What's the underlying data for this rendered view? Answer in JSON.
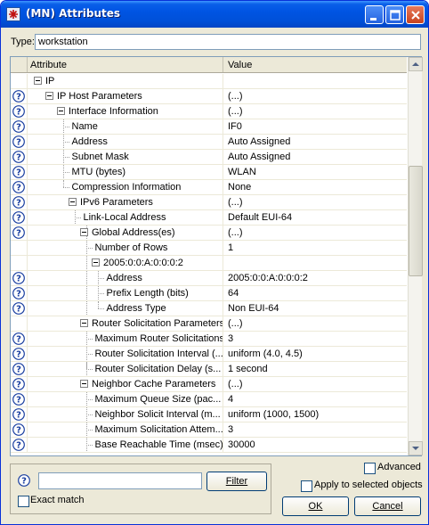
{
  "window": {
    "title": "(MN) Attributes",
    "title_icon": "asterisk-app-icon",
    "controls": {
      "minimize_icon": "minimize-icon",
      "maximize_icon": "maximize-icon",
      "close_icon": "close-icon"
    }
  },
  "type_field": {
    "label": "Type:",
    "value": "workstation"
  },
  "table": {
    "headers": {
      "attribute": "Attribute",
      "value": "Value"
    },
    "rows": [
      {
        "name": "IP",
        "value": ""
      },
      {
        "name": "IP Host Parameters",
        "value": "(...)"
      },
      {
        "name": "Interface Information",
        "value": "(...)"
      },
      {
        "name": "Name",
        "value": "IF0"
      },
      {
        "name": "Address",
        "value": "Auto Assigned"
      },
      {
        "name": "Subnet Mask",
        "value": "Auto Assigned"
      },
      {
        "name": "MTU (bytes)",
        "value": "WLAN"
      },
      {
        "name": "Compression Information",
        "value": "None"
      },
      {
        "name": "IPv6 Parameters",
        "value": "(...)"
      },
      {
        "name": "Link-Local Address",
        "value": "Default EUI-64"
      },
      {
        "name": "Global Address(es)",
        "value": "(...)"
      },
      {
        "name": "Number of Rows",
        "value": "1"
      },
      {
        "name": "2005:0:0:A:0:0:0:2",
        "value": ""
      },
      {
        "name": "Address",
        "value": "2005:0:0:A:0:0:0:2"
      },
      {
        "name": "Prefix Length (bits)",
        "value": "64"
      },
      {
        "name": "Address Type",
        "value": "Non EUI-64"
      },
      {
        "name": "Router Solicitation Parameters",
        "value": "(...)"
      },
      {
        "name": "Maximum Router Solicitations",
        "value": "3"
      },
      {
        "name": "Router Solicitation Interval (...",
        "value": "uniform (4.0, 4.5)"
      },
      {
        "name": "Router Solicitation Delay (s...",
        "value": "1 second"
      },
      {
        "name": "Neighbor Cache Parameters",
        "value": "(...)"
      },
      {
        "name": "Maximum Queue Size (pac...",
        "value": "4"
      },
      {
        "name": "Neighbor Solicit Interval (m...",
        "value": "uniform (1000, 1500)"
      },
      {
        "name": "Maximum Solicitation Attem...",
        "value": "3"
      },
      {
        "name": "Base Reachable Time (msec)",
        "value": "30000"
      }
    ]
  },
  "bottom": {
    "filter_value": "",
    "filter_button": "Filter",
    "exact_match": {
      "label": "Exact match",
      "checked": false
    },
    "advanced": {
      "label": "Advanced",
      "checked": false
    },
    "apply_selected": {
      "label": "Apply to selected objects",
      "checked": false
    },
    "ok_button": "OK",
    "cancel_button": "Cancel"
  }
}
